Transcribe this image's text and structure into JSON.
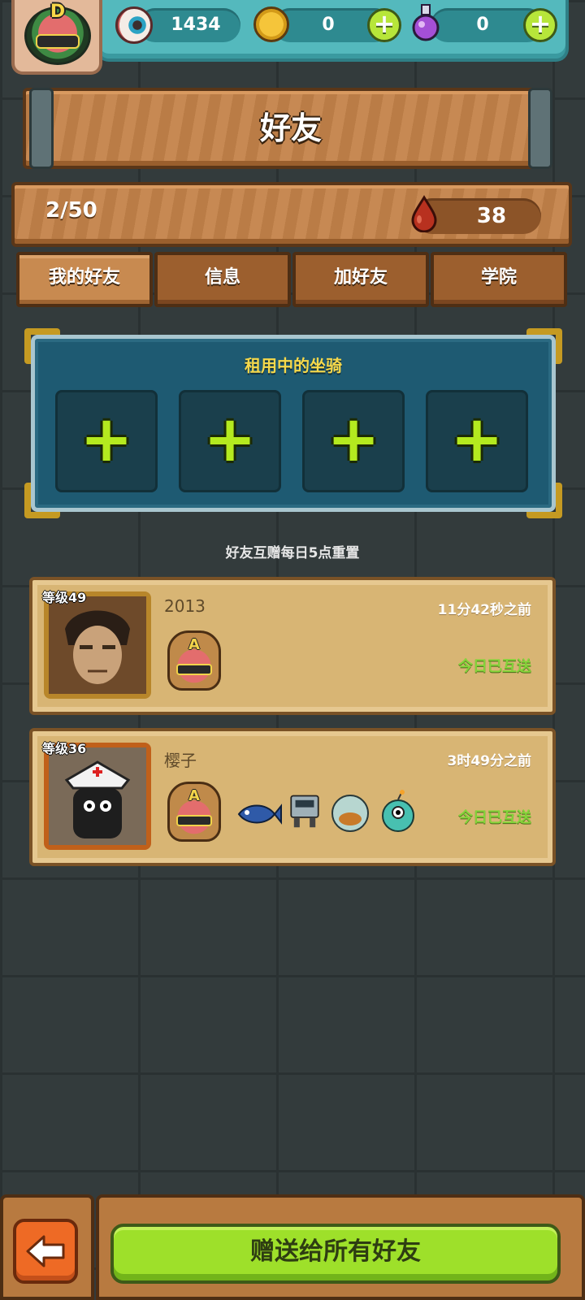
{
  "header": {
    "player_rank": "D",
    "eyeballs": "1434",
    "coins": "0",
    "potions": "0"
  },
  "title": "好友",
  "friend_count": "2/50",
  "blood": "38",
  "tabs": [
    {
      "label": "我的好友",
      "active": true
    },
    {
      "label": "信息",
      "active": false
    },
    {
      "label": "加好友",
      "active": false
    },
    {
      "label": "学院",
      "active": false
    }
  ],
  "mount_panel": {
    "title": "租用中的坐骑",
    "slots": [
      "+",
      "+",
      "+",
      "+"
    ]
  },
  "reset_note": "好友互赠每日5点重置",
  "friends": [
    {
      "level": "等级49",
      "name": "2013",
      "last_seen": "11分42秒之前",
      "gift_status": "今日已互送",
      "rank": "A",
      "vehicles": []
    },
    {
      "level": "等级36",
      "name": "樱子",
      "last_seen": "3时49分之前",
      "gift_status": "今日已互送",
      "rank": "A",
      "vehicles": [
        "fish-vehicle-icon",
        "robot-vehicle-icon",
        "bubble-vehicle-icon",
        "bomb-monster-icon"
      ]
    }
  ],
  "send_all_button": "赠送给所有好友",
  "colors": {
    "accent_green": "#9ee02a",
    "wood": "#c4834a",
    "panel_blue": "#1e5a72",
    "status_green": "#84d43a",
    "title_yellow": "#f6d84a"
  }
}
